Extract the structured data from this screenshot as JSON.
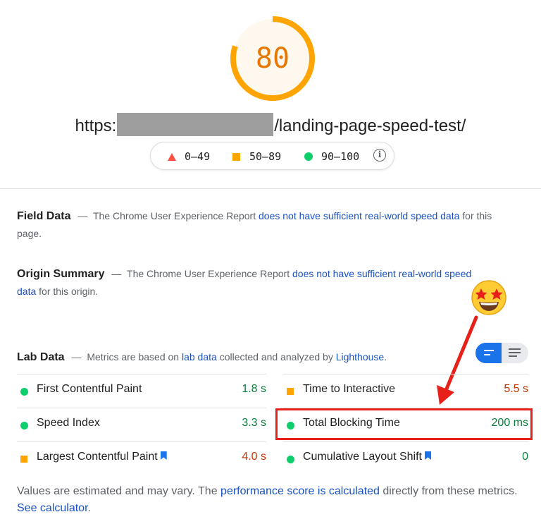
{
  "score": {
    "value": "80",
    "fraction": 0.8,
    "color": "#ffa400"
  },
  "url": {
    "prefix": "https:",
    "suffix": "/landing-page-speed-test/"
  },
  "legend": {
    "poor": "0–49",
    "average": "50–89",
    "good": "90–100"
  },
  "field_data": {
    "heading": "Field Data",
    "dash": "—",
    "text_before": "The Chrome User Experience Report",
    "link": "does not have sufficient real-world speed data",
    "text_after": "for this page."
  },
  "origin_summary": {
    "heading": "Origin Summary",
    "dash": "—",
    "text_before": "The Chrome User Experience Report",
    "link": "does not have sufficient real-world speed data",
    "text_after": "for this origin."
  },
  "lab_data": {
    "heading": "Lab Data",
    "dash": "—",
    "text_before": "Metrics are based on",
    "link1": "lab data",
    "text_middle": "collected and analyzed by",
    "link2": "Lighthouse",
    "text_after": "."
  },
  "metrics": [
    {
      "name": "First Contentful Paint",
      "value": "1.8 s",
      "status": "good"
    },
    {
      "name": "Time to Interactive",
      "value": "5.5 s",
      "status": "average"
    },
    {
      "name": "Speed Index",
      "value": "3.3 s",
      "status": "good"
    },
    {
      "name": "Total Blocking Time",
      "value": "200 ms",
      "status": "good"
    },
    {
      "name": "Largest Contentful Paint",
      "value": "4.0 s",
      "status": "average"
    },
    {
      "name": "Cumulative Layout Shift",
      "value": "0",
      "status": "good"
    }
  ],
  "footer": {
    "text_before": "Values are estimated and may vary. The",
    "link1": "performance score is calculated",
    "text_middle": "directly from these metrics.",
    "link2": "See calculator",
    "text_after": "."
  },
  "colors": {
    "good": "#0cce6b",
    "average": "#ffa400",
    "poor": "#ff4e42",
    "link": "#1a52c4",
    "annotation": "#e8201a"
  },
  "icons": [
    "triangle-icon",
    "square-icon",
    "circle-icon",
    "info-icon",
    "bookmark-icon",
    "star-struck-emoji",
    "view-toggle-icon"
  ]
}
